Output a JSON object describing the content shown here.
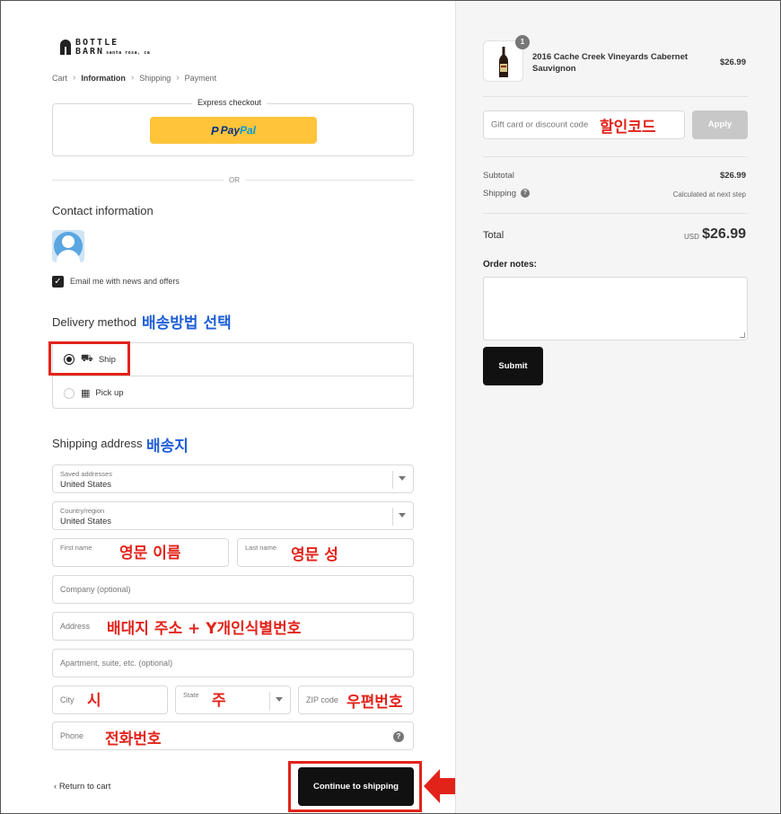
{
  "brand": {
    "name_line1": "BOTTLE",
    "name_line2": "BARN",
    "sub": "santa rosa, ca"
  },
  "breadcrumb": {
    "items": [
      "Cart",
      "Information",
      "Shipping",
      "Payment"
    ],
    "active": "Information"
  },
  "express": {
    "title": "Express checkout",
    "paypal_label": {
      "p": "P",
      "pay": "Pay",
      "pal": "Pal"
    }
  },
  "or_text": "OR",
  "contact": {
    "title": "Contact information",
    "email_opt_in": "Email me with news and offers",
    "email_opt_in_checked": true
  },
  "delivery": {
    "title": "Delivery method",
    "annotation": "배송방법 선택",
    "options": [
      {
        "label": "Ship",
        "selected": true,
        "icon": "truck-icon"
      },
      {
        "label": "Pick up",
        "selected": false,
        "icon": "store-icon"
      }
    ]
  },
  "shipping": {
    "title": "Shipping address",
    "annotation": "배송지",
    "saved_addresses": {
      "label": "Saved addresses",
      "value": "United States"
    },
    "country": {
      "label": "Country/region",
      "value": "United States"
    },
    "first_name": {
      "label": "First name",
      "annotation": "영문 이름"
    },
    "last_name": {
      "label": "Last name",
      "annotation": "영문 성"
    },
    "company": {
      "placeholder": "Company (optional)"
    },
    "address": {
      "placeholder": "Address",
      "annotation": "배대지 주소 + Y개인식별번호"
    },
    "apartment": {
      "placeholder": "Apartment, suite, etc. (optional)"
    },
    "city": {
      "placeholder": "City",
      "annotation": "시"
    },
    "state": {
      "label": "State",
      "annotation": "주"
    },
    "zip": {
      "placeholder": "ZIP code",
      "annotation": "우편번호"
    },
    "phone": {
      "placeholder": "Phone",
      "annotation": "전화번호"
    }
  },
  "actions": {
    "return_label": "Return to cart",
    "continue_label": "Continue to shipping"
  },
  "summary": {
    "item": {
      "name": "2016 Cache Creek Vineyards Cabernet Sauvignon",
      "price": "$26.99",
      "qty": "1"
    },
    "discount": {
      "placeholder": "Gift card or discount code",
      "annotation": "할인코드",
      "apply_label": "Apply"
    },
    "subtotal_label": "Subtotal",
    "subtotal_value": "$26.99",
    "shipping_label": "Shipping",
    "shipping_value": "Calculated at next step",
    "total_label": "Total",
    "total_currency": "USD",
    "total_value": "$26.99",
    "notes_label": "Order notes:",
    "submit_label": "Submit"
  },
  "colors": {
    "annotation_blue": "#1f5fd6",
    "annotation_red": "#e2231a",
    "paypal_yellow": "#ffc439",
    "button_dark": "#111111"
  }
}
